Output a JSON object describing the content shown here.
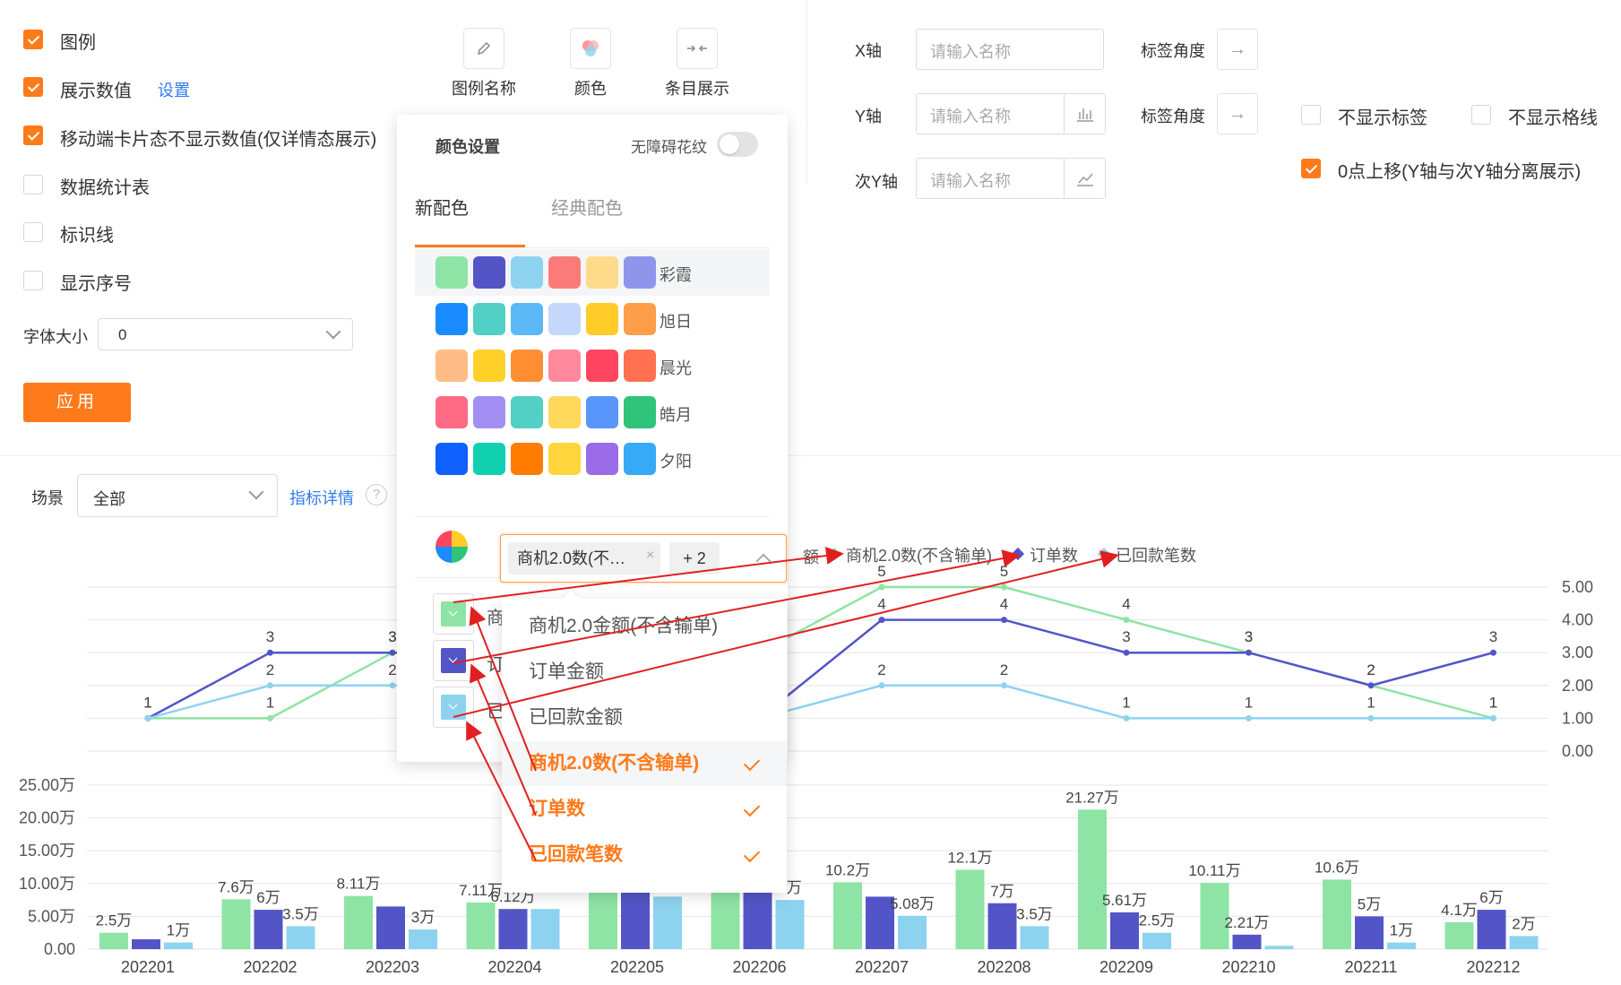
{
  "left_settings": {
    "legend": {
      "label": "图例",
      "checked": true
    },
    "show_values": {
      "label": "展示数值",
      "checked": true,
      "link": "设置"
    },
    "mobile_hide": {
      "label": "移动端卡片态不显示数值(仅详情态展示)",
      "checked": true
    },
    "stats_table": {
      "label": "数据统计表",
      "checked": false
    },
    "mark_line": {
      "label": "标识线",
      "checked": false
    },
    "show_index": {
      "label": "显示序号",
      "checked": false
    },
    "font_size": {
      "label": "字体大小",
      "value": "0"
    },
    "apply_button": "应用"
  },
  "toolbar": {
    "legend_name": "图例名称",
    "color": "颜色",
    "bar_display": "条目展示"
  },
  "axis_settings": {
    "x_axis": {
      "label": "X轴",
      "placeholder": "请输入名称",
      "angle_label": "标签角度"
    },
    "y_axis": {
      "label": "Y轴",
      "placeholder": "请输入名称",
      "angle_label": "标签角度"
    },
    "y2_axis": {
      "label": "次Y轴",
      "placeholder": "请输入名称"
    },
    "hide_labels": {
      "label": "不显示标签",
      "checked": false
    },
    "hide_grid": {
      "label": "不显示格线",
      "checked": false
    },
    "zero_up": {
      "label": "0点上移(Y轴与次Y轴分离展示)",
      "checked": true
    }
  },
  "filter_bar": {
    "scene_label": "场景",
    "scene_value": "全部",
    "metric_detail": "指标详情",
    "help_icon": "?"
  },
  "color_panel": {
    "title": "颜色设置",
    "accessibility_label": "无障碍花纹",
    "tabs": [
      "新配色",
      "经典配色"
    ],
    "palettes": [
      {
        "name": "彩霞",
        "colors": [
          "#8ee4a4",
          "#5355c7",
          "#8dd3f0",
          "#fb7b7b",
          "#fedb8a",
          "#8e96ec"
        ]
      },
      {
        "name": "旭日",
        "colors": [
          "#1a8cff",
          "#52d0c5",
          "#5cb8f7",
          "#c5d8fb",
          "#ffcc2a",
          "#ff9e4a"
        ]
      },
      {
        "name": "晨光",
        "colors": [
          "#ffbc86",
          "#ffd128",
          "#ff8e33",
          "#ff889c",
          "#ff4560",
          "#ff7150"
        ]
      },
      {
        "name": "皓月",
        "colors": [
          "#ff6a84",
          "#a38ef4",
          "#52d0c5",
          "#ffd85c",
          "#5896fb",
          "#2fc47a"
        ]
      },
      {
        "name": "夕阳",
        "colors": [
          "#1060ff",
          "#10d0b0",
          "#ff7c00",
          "#ffd43c",
          "#9a6ce8",
          "#36a9f7"
        ]
      }
    ],
    "legend_items": [
      {
        "name": "商",
        "color": "#8ee4a4"
      },
      {
        "name": "订",
        "color": "#5355c7"
      },
      {
        "name": "已",
        "color": "#8dd3f0"
      }
    ]
  },
  "series_select": {
    "tag": "商机2.0数(不…",
    "more": "+ 2",
    "options": [
      {
        "label": "商机2.0金额(不含输单)",
        "selected": false
      },
      {
        "label": "订单金额",
        "selected": false
      },
      {
        "label": "已回款金额",
        "selected": false
      },
      {
        "label": "商机2.0数(不含输单)",
        "selected": true
      },
      {
        "label": "订单数",
        "selected": true
      },
      {
        "label": "已回款笔数",
        "selected": true
      }
    ]
  },
  "chart_legend": {
    "partial": "额",
    "items": [
      {
        "name": "商机2.0数(不含输单)",
        "color": "#8ee4a4"
      },
      {
        "name": "订单数",
        "color": "#5355c7"
      },
      {
        "name": "已回款笔数",
        "color": "#8dd3f0"
      }
    ]
  },
  "chart_data": [
    {
      "type": "line",
      "x": [
        "202201",
        "202202",
        "202203",
        "202204",
        "202205",
        "202206",
        "202207",
        "202208",
        "202209",
        "202210",
        "202211",
        "202212"
      ],
      "ylim": [
        0,
        5
      ],
      "y_ticks": [
        "0.00",
        "1.00",
        "2.00",
        "3.00",
        "4.00",
        "5.00"
      ],
      "series": [
        {
          "name": "商机2.0数(不含输单)",
          "color": "#8ee4a4",
          "values": [
            1,
            1,
            3,
            3,
            3,
            3,
            5,
            5,
            4,
            3,
            2,
            1
          ]
        },
        {
          "name": "订单数",
          "color": "#5355c7",
          "values": [
            1,
            3,
            3,
            3,
            3,
            1,
            4,
            4,
            3,
            3,
            2,
            3
          ]
        },
        {
          "name": "已回款笔数",
          "color": "#8dd3f0",
          "values": [
            1,
            2,
            2,
            2,
            1,
            1,
            2,
            2,
            1,
            1,
            1,
            1
          ]
        }
      ]
    },
    {
      "type": "bar",
      "categories": [
        "202201",
        "202202",
        "202203",
        "202204",
        "202205",
        "202206",
        "202207",
        "202208",
        "202209",
        "202210",
        "202211",
        "202212"
      ],
      "ylim": [
        0,
        25
      ],
      "y_ticks": [
        "0.00",
        "5.00万",
        "10.00万",
        "15.00万",
        "20.00万",
        "25.00万"
      ],
      "series": [
        {
          "name": "商机2.0金额(不含输单)",
          "color": "#8ee4a4",
          "values": [
            2.5,
            7.6,
            8.11,
            7.11,
            10.0,
            10.0,
            10.2,
            12.1,
            21.27,
            10.11,
            10.6,
            4.1
          ],
          "labels": [
            "2.5万",
            "7.6万",
            "8.11万",
            "7.11万",
            "",
            "",
            "10.2万",
            "12.1万",
            "21.27万",
            "10.11万",
            "10.6万",
            "4.1万"
          ]
        },
        {
          "name": "订单金额",
          "color": "#5355c7",
          "values": [
            1.5,
            6,
            6.5,
            6.12,
            9,
            9.5,
            8,
            7,
            5.61,
            2.21,
            5,
            6
          ],
          "labels": [
            "",
            "6万",
            "",
            "6.12万",
            "",
            "",
            "",
            "7万",
            "5.61万",
            "2.21万",
            "5万",
            "6万"
          ]
        },
        {
          "name": "已回款金额",
          "color": "#8dd3f0",
          "values": [
            1,
            3.5,
            3,
            6.12,
            8,
            7.5,
            5.08,
            3.5,
            2.5,
            0.5,
            1,
            2
          ],
          "labels": [
            "1万",
            "3.5万",
            "3万",
            "",
            "",
            "5万",
            "5.08万",
            "3.5万",
            "2.5万",
            "",
            "1万",
            "2万"
          ]
        }
      ]
    }
  ]
}
